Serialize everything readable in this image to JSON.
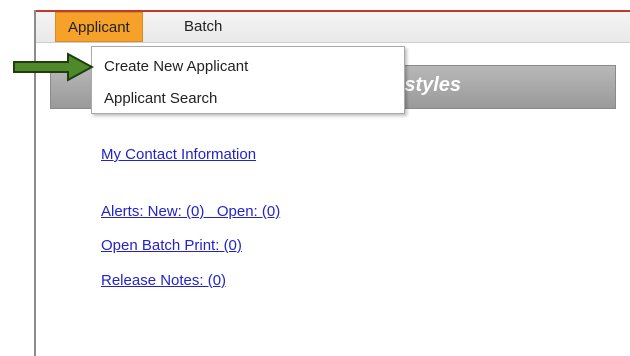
{
  "menubar": {
    "items": [
      {
        "label": "Applicant"
      },
      {
        "label": "Batch"
      }
    ]
  },
  "header": {
    "title_fragment": "r styles"
  },
  "dropdown": {
    "items": [
      {
        "label": "Create New Applicant"
      },
      {
        "label": "Applicant Search"
      }
    ]
  },
  "links": [
    {
      "label": "My Contact Information"
    },
    {
      "label": "Alerts: New: (0)   Open: (0)"
    },
    {
      "label": "Open Batch Print: (0)"
    },
    {
      "label": "Release Notes: (0)"
    }
  ],
  "colors": {
    "menu_active": "#f5a12a",
    "link": "#2323c9",
    "arrow": "#4e8a2a",
    "header_bar": "#a6a6a6"
  },
  "icons": {
    "pointer": "right-arrow-icon"
  }
}
